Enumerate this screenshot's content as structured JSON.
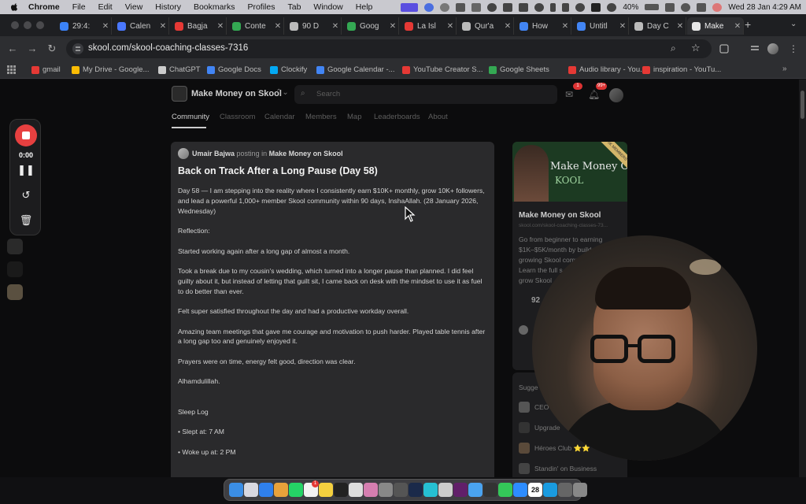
{
  "menubar": {
    "app": "Chrome",
    "items": [
      "File",
      "Edit",
      "View",
      "History",
      "Bookmarks",
      "Profiles",
      "Tab",
      "Window",
      "Help"
    ],
    "battery": "40%",
    "datetime": "Wed 28 Jan  4:29 AM"
  },
  "tabs": [
    {
      "label": "29:4:",
      "color": "#3b82f6"
    },
    {
      "label": "Calen",
      "color": "#4a78ff"
    },
    {
      "label": "Bagja",
      "color": "#e53935"
    },
    {
      "label": "Conte",
      "color": "#34a853"
    },
    {
      "label": "90 D",
      "color": "#bbbbbb"
    },
    {
      "label": "Goog",
      "color": "#34a853"
    },
    {
      "label": "La Isl",
      "color": "#e53935"
    },
    {
      "label": "Qur'a",
      "color": "#bbbbbb"
    },
    {
      "label": "How",
      "color": "#4285f4"
    },
    {
      "label": "Untitl",
      "color": "#4285f4"
    },
    {
      "label": "Day C",
      "color": "#bbbbbb"
    },
    {
      "label": "Make",
      "color": "#e8e8e8",
      "active": true
    }
  ],
  "toolbar": {
    "url": "skool.com/skool-coaching-classes-7316"
  },
  "bookmarks": [
    {
      "label": "gmail",
      "color": "#e53935"
    },
    {
      "label": "My Drive - Google...",
      "color": "#fbbc04"
    },
    {
      "label": "ChatGPT",
      "color": "#cccccc"
    },
    {
      "label": "Google Docs",
      "color": "#4285f4"
    },
    {
      "label": "Clockify",
      "color": "#03a9f4"
    },
    {
      "label": "Google Calendar -...",
      "color": "#4285f4"
    },
    {
      "label": "YouTube Creator S...",
      "color": "#e53935"
    },
    {
      "label": "Google Sheets",
      "color": "#34a853"
    },
    {
      "label": "Audio library - You...",
      "color": "#e53935"
    },
    {
      "label": "inspiration - YouTu...",
      "color": "#e53935"
    }
  ],
  "skool": {
    "group_name": "Make Money on Skool",
    "search_placeholder": "Search",
    "chat_badge": "1",
    "notif_badge": "99+",
    "nav": [
      "Community",
      "Classroom",
      "Calendar",
      "Members",
      "Map",
      "Leaderboards",
      "About"
    ]
  },
  "post": {
    "author": "Umair Bajwa",
    "posting_in": "posting in",
    "group": "Make Money on Skool",
    "title": "Back on Track After a Long Pause (Day 58)",
    "lines": [
      "Day 58 — I am stepping into the reality where I consistently earn $10K+ monthly, grow 10K+ followers,",
      "and lead a powerful 1,000+ member Skool community within 90 days, InshaAllah. (28 January 2026,",
      "Wednesday)",
      "",
      "Reflection:",
      "",
      "Started working again after a long gap of almost a month.",
      "",
      "Took a break due to my cousin's wedding, which turned into a longer pause than planned. I did feel",
      "guilty about it, but instead of letting that guilt sit, I came back on desk with the mindset to use it as fuel",
      "to do better than ever.",
      "",
      "Felt super satisfied throughout the day and had a productive workday overall.",
      "",
      "Amazing team meetings that gave me courage and motivation to push harder. Played table tennis after",
      "a long gap too and genuinely enjoyed it.",
      "",
      "Prayers were on time, energy felt good, direction was clear.",
      "",
      "Alhamdulillah.",
      "",
      "",
      " Sleep Log",
      "",
      "• Slept at: 7 AM",
      "",
      "• Woke up at: 2 PM"
    ]
  },
  "sidebar": {
    "cover_text": "Make Money O",
    "cover_text2": "KOOL",
    "ribbon": "5K MEMBERS",
    "name": "Make Money on Skool",
    "url": "skool.com/skool-coaching-classes-73...",
    "desc": [
      "Go from beginner to earning",
      "$1K–$5K/month by build",
      "growing Skool comm",
      "Learn the full s",
      "grow Skool"
    ],
    "stat": "92",
    "suggested_title": "Sugge",
    "suggested": [
      "CEO",
      "Upgrade",
      "Héroes Club ⭐⭐",
      "Standin' on Business"
    ]
  },
  "recorder": {
    "time": "0:00"
  },
  "dock": {
    "calendar_day": "28",
    "mail_badge": "1"
  }
}
